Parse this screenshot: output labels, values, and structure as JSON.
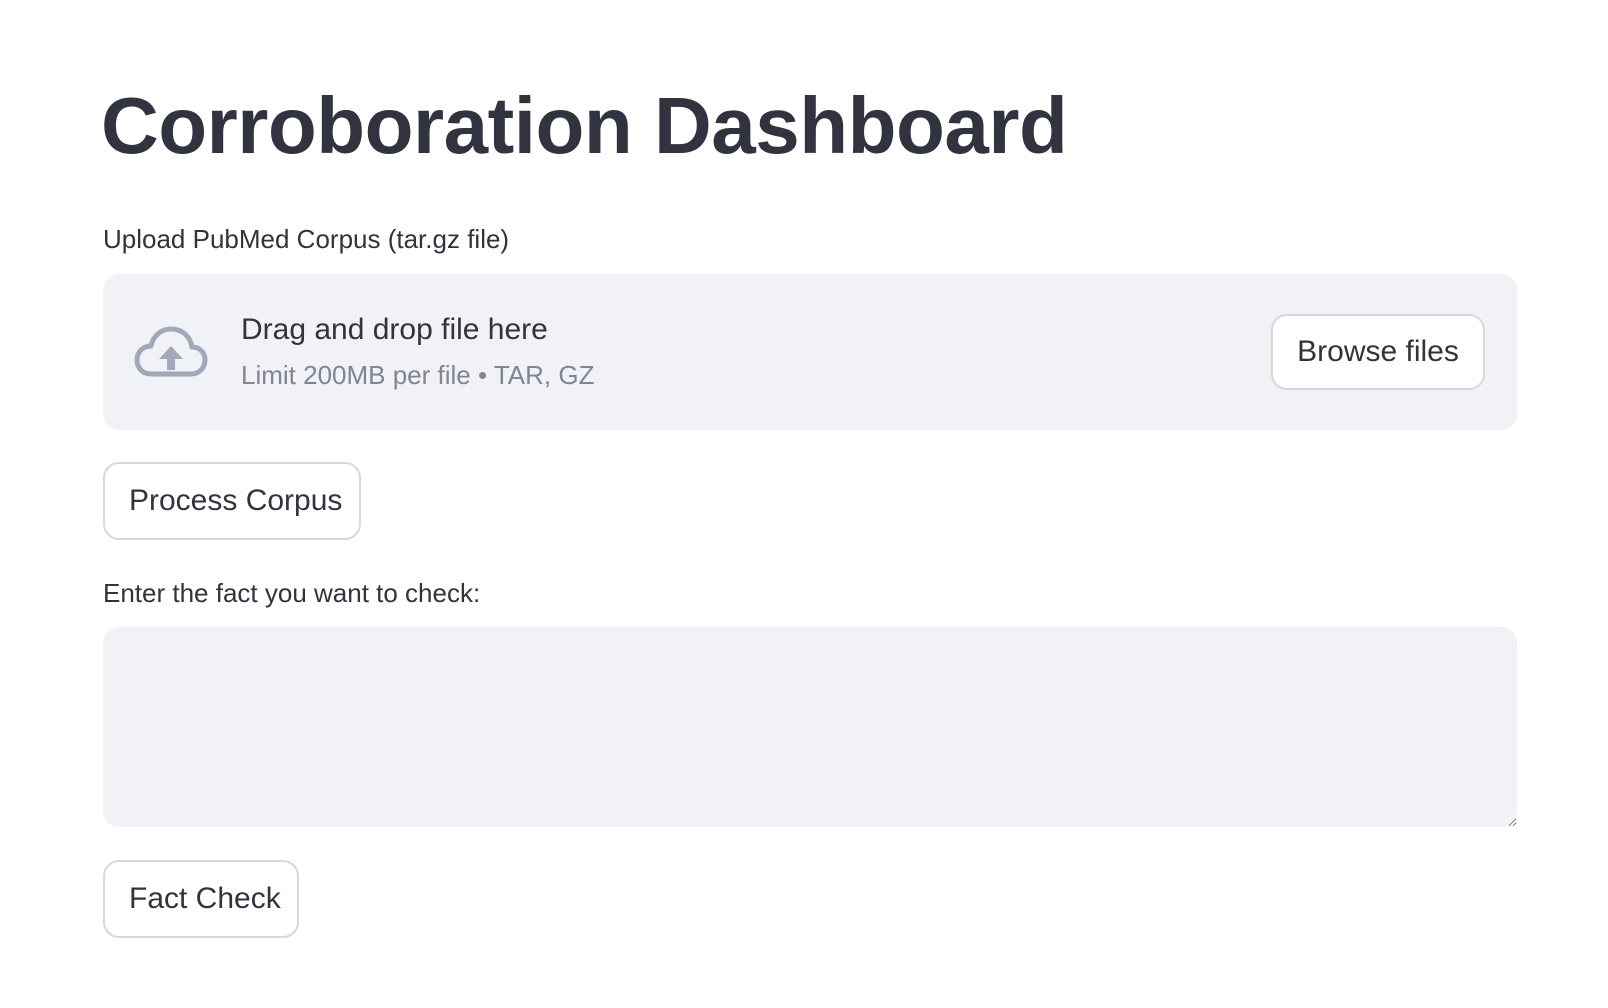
{
  "page": {
    "title": "Corroboration Dashboard"
  },
  "uploader": {
    "label": "Upload PubMed Corpus (tar.gz file)",
    "dropzone_title": "Drag and drop file here",
    "dropzone_subtitle": "Limit 200MB per file • TAR, GZ",
    "browse_label": "Browse files",
    "icon": "cloud-upload-icon"
  },
  "process": {
    "button_label": "Process Corpus"
  },
  "fact_input": {
    "label": "Enter the fact you want to check:",
    "value": "",
    "placeholder": ""
  },
  "fact_check": {
    "button_label": "Fact Check"
  },
  "colors": {
    "text": "#31333f",
    "muted_text": "#808495",
    "field_background": "#f0f2f6",
    "border": "#d6d8de",
    "icon": "#a3a8b8"
  }
}
